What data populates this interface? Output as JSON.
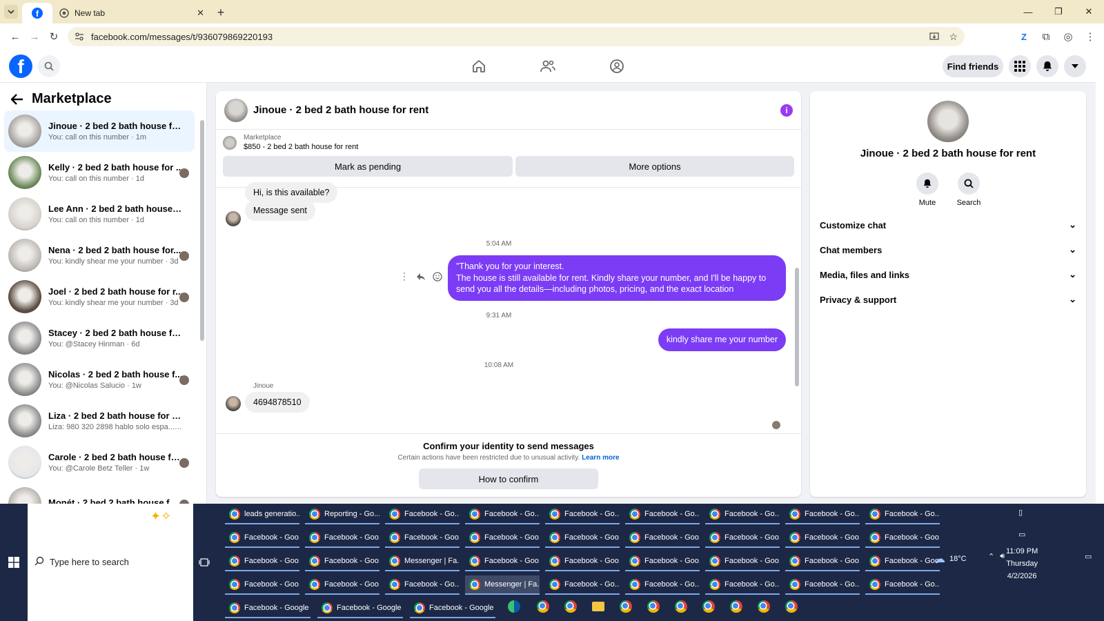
{
  "browser": {
    "tab_newtab_title": "New tab",
    "url": "facebook.com/messages/t/936079869220193"
  },
  "facebook": {
    "find_friends": "Find friends"
  },
  "marketplace": {
    "title": "Marketplace",
    "conversations": [
      {
        "name": "Jinoue · 2 bed 2 bath house for r...",
        "preview": "You: call on this number · 1m",
        "active": true
      },
      {
        "name": "Kelly · 2 bed 2 bath house for ...",
        "preview": "You: call on this number · 1d"
      },
      {
        "name": "Lee Ann · 2 bed 2 bath house fo...",
        "preview": "You: call on this number · 1d"
      },
      {
        "name": "Nena · 2 bed 2 bath house for...",
        "preview": "You: kindly shear me your number · 3d"
      },
      {
        "name": "Joel · 2 bed 2 bath house for r...",
        "preview": "You: kindly shear me your number · 3d"
      },
      {
        "name": "Stacey · 2 bed 2 bath house for r...",
        "preview": "You: @Stacey Hinman · 6d"
      },
      {
        "name": "Nicolas · 2 bed 2 bath house f...",
        "preview": "You: @Nicolas Salucio · 1w"
      },
      {
        "name": "Liza · 2 bed 2 bath house for rent",
        "preview": "Liza: 980 320 2898 hablo solo espa... · 1w"
      },
      {
        "name": "Carole · 2 bed 2 bath house fo...",
        "preview": "You: @Carole Betz Teller · 1w"
      },
      {
        "name": "Monét · 2 bed 2 bath house f...",
        "preview": ""
      }
    ]
  },
  "chat": {
    "title": "Jinoue · 2 bed 2 bath house for rent",
    "listing_source": "Marketplace",
    "listing_price": "$850 - 2 bed 2 bath house for rent",
    "mark_pending": "Mark as pending",
    "more_options": "More options",
    "msg_available": "Hi, is this available?",
    "msg_sent": "Message sent",
    "ts1": "5:04 AM",
    "out1_line1": "\"Thank you for your interest.",
    "out1_line2": "The house is still available for rent. Kindly share your number, and I'll be happy to",
    "out1_line3": "send you all the details—including photos, pricing, and the exact location",
    "ts2": "9:31 AM",
    "out2": "kindly share me your number",
    "ts3": "10:08 AM",
    "sender": "Jinoue",
    "in_number": "4694878510",
    "confirm_title": "Confirm your identity to send messages",
    "confirm_sub": "Certain actions have been restricted due to unusual activity.",
    "learn_more": "Learn more",
    "how_to_confirm": "How to confirm"
  },
  "details": {
    "name": "Jinoue · 2 bed 2 bath house for rent",
    "mute": "Mute",
    "search": "Search",
    "sections": [
      "Customize chat",
      "Chat members",
      "Media, files and links",
      "Privacy & support"
    ]
  },
  "taskbar": {
    "search_placeholder": "Type here to search",
    "windows": [
      [
        "leads generatio...",
        "Reporting - Go...",
        "Facebook - Go...",
        "Facebook - Go...",
        "Facebook - Go...",
        "Facebook - Go...",
        "Facebook - Go...",
        "Facebook - Go...",
        "Facebook - Go..."
      ],
      [
        "Facebook - Goo...",
        "Facebook - Goo...",
        "Facebook - Goo...",
        "Facebook - Goo...",
        "Facebook - Goo...",
        "Facebook - Goo...",
        "Facebook - Goo...",
        "Facebook - Goo...",
        "Facebook - Goo..."
      ],
      [
        "Facebook - Goo...",
        "Facebook - Goo...",
        "Messenger | Fa...",
        "Facebook - Goo...",
        "Facebook - Goo...",
        "Facebook - Goo...",
        "Facebook - Goo...",
        "Facebook - Goo...",
        "Facebook - Goo..."
      ],
      [
        "Facebook - Goo...",
        "Facebook - Goo...",
        "Facebook - Go...",
        "Messenger | Fa...",
        "Facebook - Go...",
        "Facebook - Go...",
        "Facebook - Go...",
        "Facebook - Go...",
        "Facebook - Go..."
      ],
      [
        "Facebook - Google ...",
        "Facebook - Google ...",
        "Facebook - Google ..."
      ]
    ],
    "weather": "18°C",
    "time": "11:09 PM",
    "day": "Thursday",
    "date": "4/2/2026"
  }
}
